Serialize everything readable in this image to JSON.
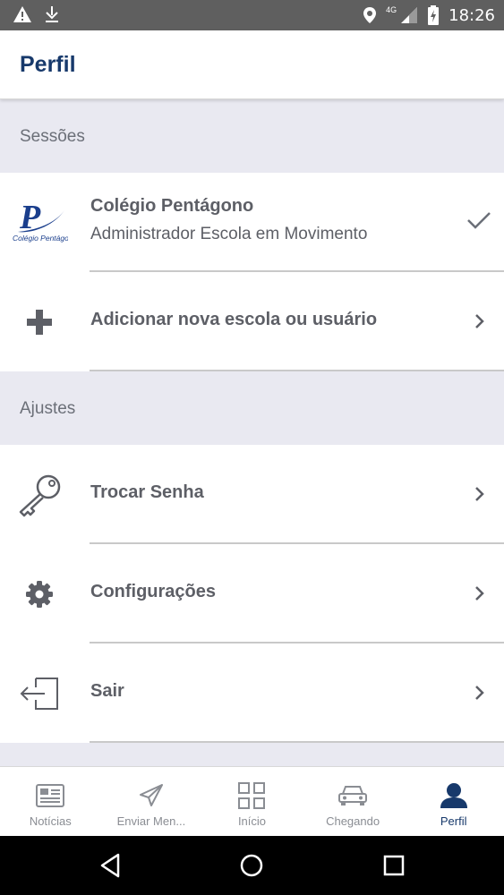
{
  "status_bar": {
    "time": "18:26",
    "network": "4G",
    "icons": [
      "warning-icon",
      "download-icon",
      "location-icon",
      "signal-icon",
      "battery-icon"
    ]
  },
  "header": {
    "title": "Perfil"
  },
  "sections": {
    "sessions": {
      "label": "Sessões",
      "session": {
        "school": "Colégio Pentágono",
        "role": "Administrador Escola em Movimento",
        "logo_text": "Colégio Pentágono",
        "logo_letter": "P"
      },
      "add_label": "Adicionar nova escola ou usuário"
    },
    "settings": {
      "label": "Ajustes",
      "items": [
        {
          "label": "Trocar Senha",
          "icon": "key-icon"
        },
        {
          "label": "Configurações",
          "icon": "gear-icon"
        },
        {
          "label": "Sair",
          "icon": "logout-icon"
        }
      ]
    }
  },
  "bottom_nav": [
    {
      "label": "Notícias",
      "icon": "news-icon"
    },
    {
      "label": "Enviar Men...",
      "icon": "send-icon"
    },
    {
      "label": "Início",
      "icon": "grid-icon"
    },
    {
      "label": "Chegando",
      "icon": "car-icon"
    },
    {
      "label": "Perfil",
      "icon": "user-icon",
      "active": true
    }
  ],
  "colors": {
    "brand": "#17396b",
    "section_bg": "#e9e9f1",
    "text": "#5d5f66",
    "inactive": "#8a8d93",
    "status_bar": "#5f5f5f"
  }
}
